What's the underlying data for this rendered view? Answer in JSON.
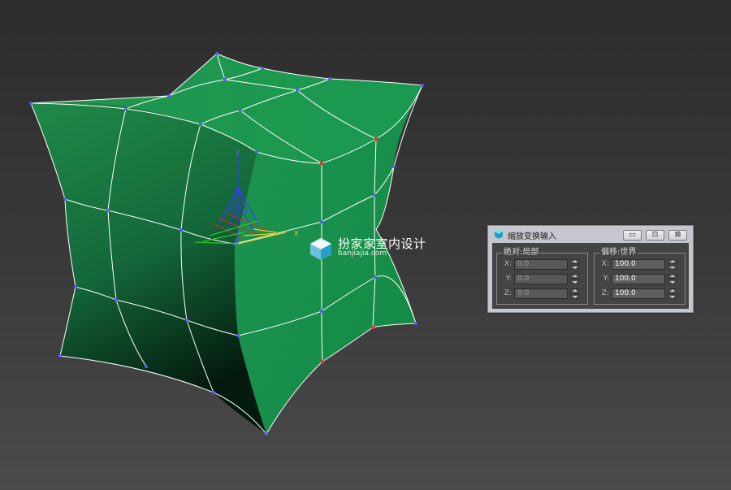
{
  "viewport": {
    "object_color": "#1f8c4a",
    "wire_color": "#ffffff",
    "vertex_color": "#5a5aff",
    "selected_vertex_color": "#ff2a2a",
    "gizmo_labels": {
      "z": "Z",
      "x": "X"
    }
  },
  "watermark": {
    "title": "扮家家室内设计",
    "url": "banjiajia.com"
  },
  "dialog": {
    "title": "缩放变换输入",
    "icon": "3dsmax-app-icon",
    "buttons": {
      "minimize": "▭",
      "restore": "⊡",
      "close": "⊠"
    },
    "absolute": {
      "label": "绝对:局部",
      "rows": [
        {
          "axis": "X:",
          "value": "0.0"
        },
        {
          "axis": "Y:",
          "value": "0.0"
        },
        {
          "axis": "Z:",
          "value": "0.0"
        }
      ]
    },
    "offset": {
      "label": "偏移:世界",
      "rows": [
        {
          "axis": "X:",
          "value": "100.0"
        },
        {
          "axis": "Y:",
          "value": "100.0"
        },
        {
          "axis": "Z:",
          "value": "100.0"
        }
      ]
    }
  }
}
